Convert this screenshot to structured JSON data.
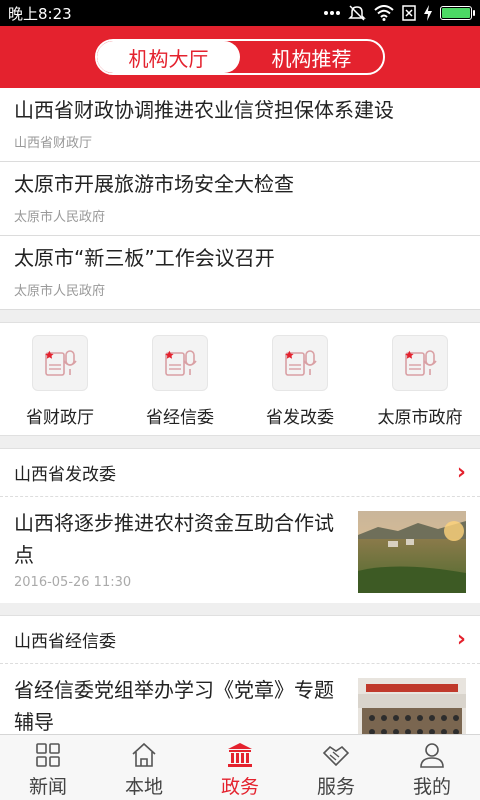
{
  "status_bar": {
    "time": "晚上8:23",
    "icons": [
      "more-dots-icon",
      "mute-icon",
      "wifi-icon",
      "sim-icon",
      "charging-icon",
      "battery-icon"
    ],
    "battery_level": 1.0
  },
  "header": {
    "tabs": [
      {
        "label": "机构大厅",
        "active": true
      },
      {
        "label": "机构推荐",
        "active": false
      }
    ]
  },
  "news": [
    {
      "title": "山西省财政协调推进农业信贷担保体系建设",
      "source": "山西省财政厅"
    },
    {
      "title": "太原市开展旅游市场安全大检查",
      "source": "太原市人民政府"
    },
    {
      "title": "太原市“新三板”工作会议召开",
      "source": "太原市人民政府"
    }
  ],
  "orgs": [
    {
      "label": "省财政厅",
      "icon": "org-badge-icon"
    },
    {
      "label": "省经信委",
      "icon": "org-badge-icon"
    },
    {
      "label": "省发改委",
      "icon": "org-badge-icon"
    },
    {
      "label": "太原市政府",
      "icon": "org-badge-icon"
    }
  ],
  "sections": [
    {
      "title": "山西省发改委",
      "article": {
        "title": "山西将逐步推进农村资金互助合作试点",
        "time": "2016-05-26 11:30"
      }
    },
    {
      "title": "山西省经信委",
      "article": {
        "title": "省经信委党组举办学习《党章》专题辅导",
        "time": ""
      }
    }
  ],
  "tabbar": [
    {
      "label": "新闻",
      "icon": "grid-icon",
      "active": false
    },
    {
      "label": "本地",
      "icon": "house-icon",
      "active": false
    },
    {
      "label": "政务",
      "icon": "government-building-icon",
      "active": true
    },
    {
      "label": "服务",
      "icon": "handshake-icon",
      "active": false
    },
    {
      "label": "我的",
      "icon": "user-icon",
      "active": false
    }
  ],
  "colors": {
    "accent": "#e4222e",
    "background": "#efefef"
  }
}
